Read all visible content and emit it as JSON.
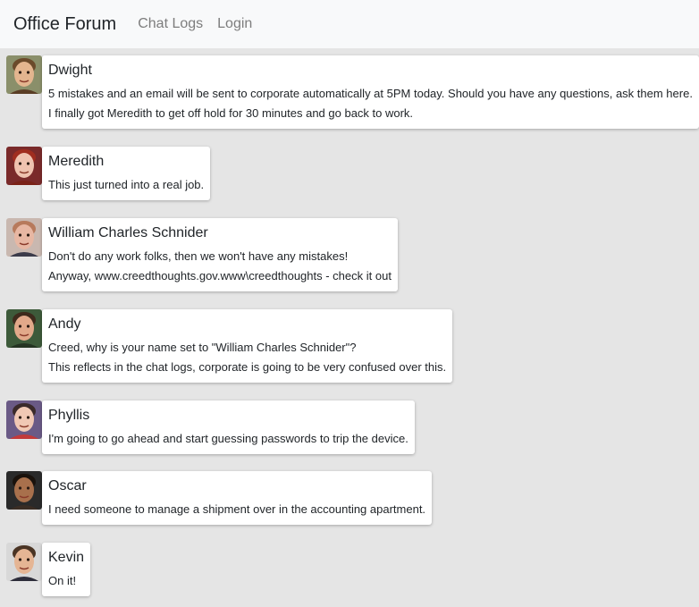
{
  "navbar": {
    "brand": "Office Forum",
    "links": [
      "Chat Logs",
      "Login"
    ]
  },
  "messages": [
    {
      "author": "Dwight",
      "avatar_icon": "dwight-avatar-icon",
      "lines": [
        "5 mistakes and an email will be sent to corporate automatically at 5PM today. Should you have any questions, ask them here.",
        "I finally got Meredith to get off hold for 30 minutes and go back to work."
      ]
    },
    {
      "author": "Meredith",
      "avatar_icon": "meredith-avatar-icon",
      "lines": [
        "This just turned into a real job."
      ]
    },
    {
      "author": "William Charles Schnider",
      "avatar_icon": "william-avatar-icon",
      "lines": [
        "Don't do any work folks, then we won't have any mistakes!",
        "Anyway, www.creedthoughts.gov.www\\creedthoughts - check it out"
      ]
    },
    {
      "author": "Andy",
      "avatar_icon": "andy-avatar-icon",
      "lines": [
        "Creed, why is your name set to \"William Charles Schnider\"?",
        "This reflects in the chat logs, corporate is going to be very confused over this."
      ]
    },
    {
      "author": "Phyllis",
      "avatar_icon": "phyllis-avatar-icon",
      "lines": [
        "I'm going to go ahead and start guessing passwords to trip the device."
      ]
    },
    {
      "author": "Oscar",
      "avatar_icon": "oscar-avatar-icon",
      "lines": [
        "I need someone to manage a shipment over in the accounting apartment."
      ]
    },
    {
      "author": "Kevin",
      "avatar_icon": "kevin-avatar-icon",
      "lines": [
        "On it!"
      ]
    }
  ],
  "colors": {
    "page_background": "#e5e5e5",
    "navbar_background": "#f8f9fa",
    "card_background": "#ffffff",
    "nav_link": "#7d7d7d"
  }
}
